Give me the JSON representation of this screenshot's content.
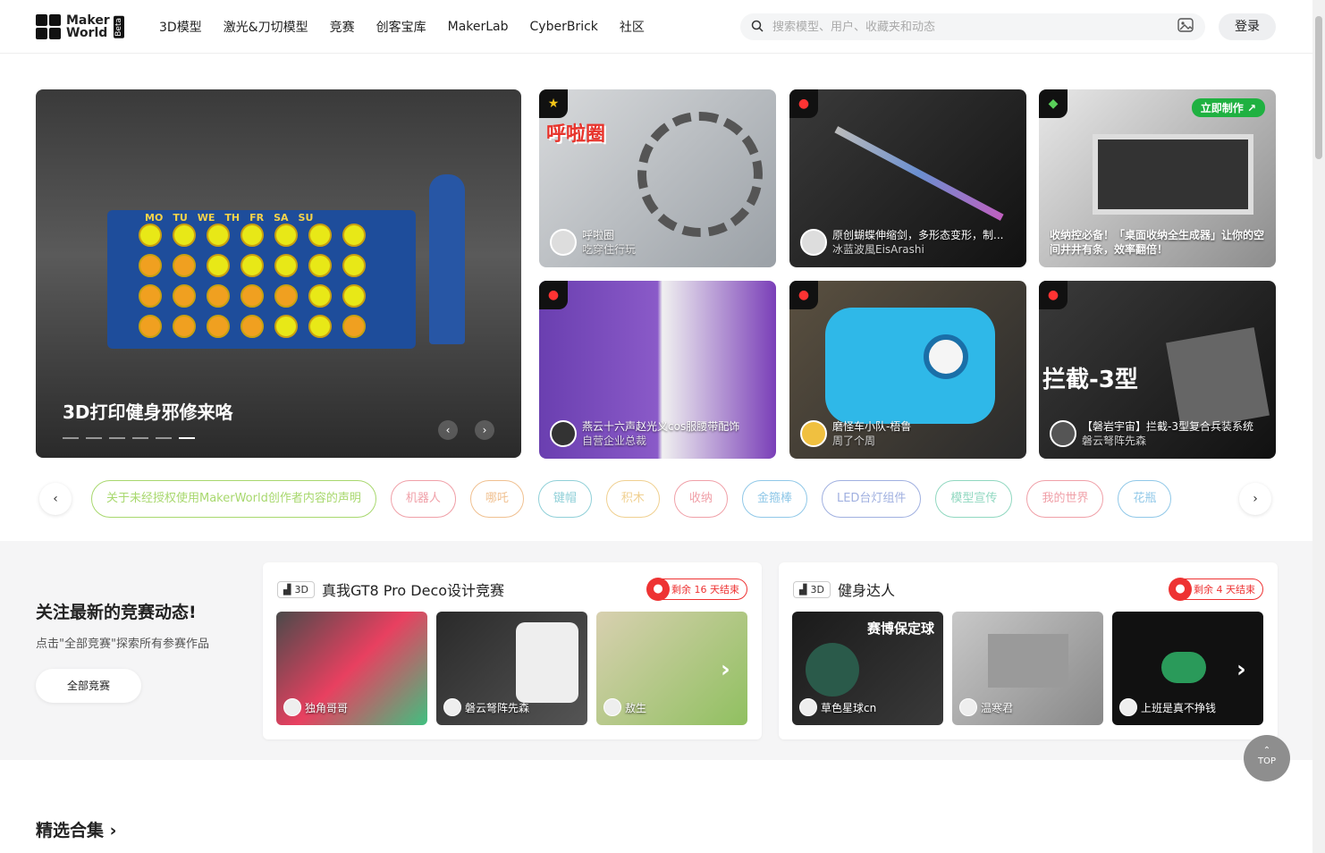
{
  "header": {
    "logo_text_1": "Maker",
    "logo_text_2": "World",
    "logo_beta": "Beta",
    "nav": [
      "3D模型",
      "激光&刀切模型",
      "竞赛",
      "创客宝库",
      "MakerLab",
      "CyberBrick",
      "社区"
    ],
    "search_placeholder": "搜索模型、用户、收藏夹和动态",
    "login_label": "登录"
  },
  "hero": {
    "main_title": "3D打印健身邪修来咯",
    "days": [
      "MO",
      "TU",
      "WE",
      "TH",
      "FR",
      "SA",
      "SU"
    ],
    "cards": [
      {
        "title": "呼啦圈",
        "sub": "吃穿住行玩",
        "overlay": "呼啦圈"
      },
      {
        "title": "原创蝴蝶伸缩剑，多形态变形，制...",
        "sub": "冰蓝波風EisArashi"
      },
      {
        "title": "收纳控必备！「桌面收纳全生成器」让你的空间井井有条，效率翻倍！",
        "sub": "",
        "make_now": "立即制作 ↗"
      },
      {
        "title": "燕云十六声赵光义cos服腰带配饰",
        "sub": "自营企业总裁"
      },
      {
        "title": "磨怪车小队-梧鲁",
        "sub": "周了个周"
      },
      {
        "title": "【磐岩宇宙】拦截-3型复合兵装系统",
        "sub": "磐云弩阵先森",
        "overlay": "拦截-3型"
      }
    ]
  },
  "tags": [
    {
      "label": "关于未经授权使用MakerWorld创作者内容的声明",
      "color": "#a8d86e"
    },
    {
      "label": "机器人",
      "color": "#f0a0a8"
    },
    {
      "label": "哪吒",
      "color": "#f0c090"
    },
    {
      "label": "键帽",
      "color": "#90d0d8"
    },
    {
      "label": "积木",
      "color": "#f0d090"
    },
    {
      "label": "收纳",
      "color": "#f0a0a8"
    },
    {
      "label": "金箍棒",
      "color": "#90c8e8"
    },
    {
      "label": "LED台灯组件",
      "color": "#a0b0e0"
    },
    {
      "label": "模型宣传",
      "color": "#90d8c0"
    },
    {
      "label": "我的世界",
      "color": "#f0a0a8"
    },
    {
      "label": "花瓶",
      "color": "#90c8e8"
    }
  ],
  "contest": {
    "heading": "关注最新的竞赛动态!",
    "sub": "点击\"全部竞赛\"探索所有参赛作品",
    "all_label": "全部竞赛",
    "panels": [
      {
        "type": "3D",
        "title": "真我GT8 Pro Deco设计竞赛",
        "remain": "剩余 16 天结束",
        "items": [
          {
            "author": "独角哥哥"
          },
          {
            "author": "磐云弩阵先森"
          },
          {
            "author": "敖生"
          }
        ]
      },
      {
        "type": "3D",
        "title": "健身达人",
        "remain": "剩余 4 天结束",
        "items": [
          {
            "author": "草色星球cn",
            "overlay": "赛博保定球"
          },
          {
            "author": "温寒君"
          },
          {
            "author": "上班是真不挣钱"
          }
        ]
      }
    ]
  },
  "collections": {
    "title": "精选合集"
  },
  "top_button": "TOP",
  "colors": {
    "accent_red": "#e33333",
    "make_green": "#1fb141"
  }
}
